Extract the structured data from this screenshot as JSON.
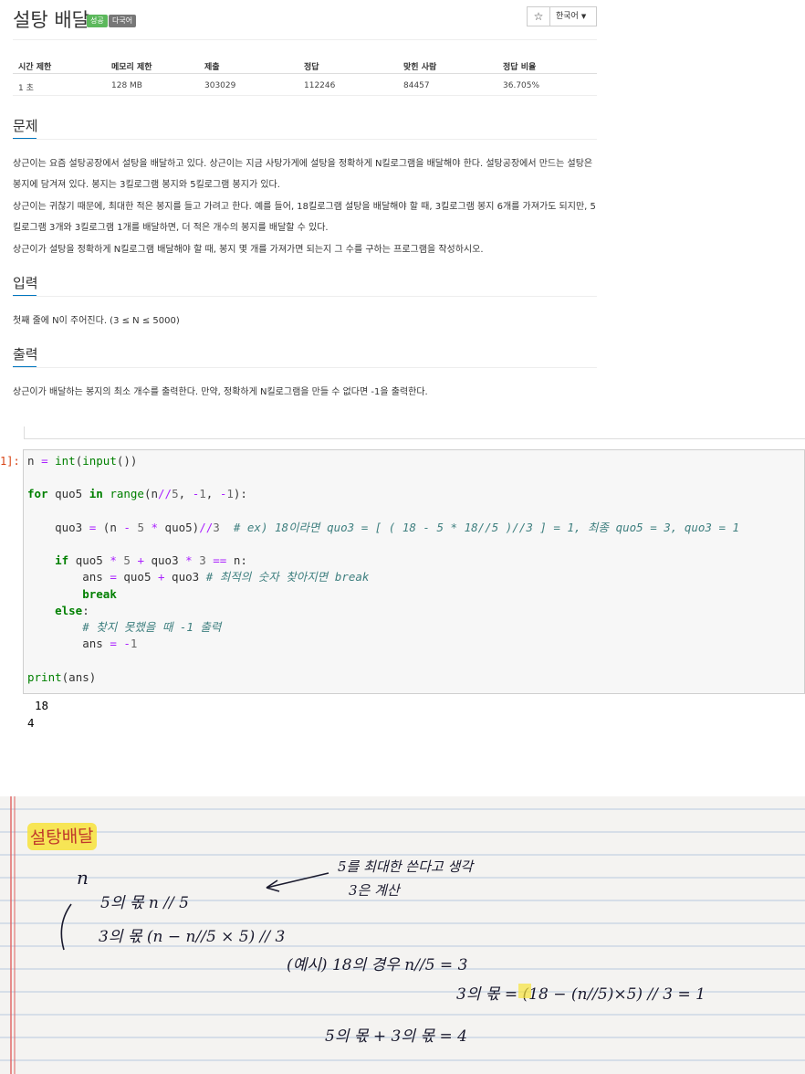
{
  "problem": {
    "title": "설탕 배달",
    "badge_success": "성공",
    "badge_multilang": "다국어",
    "star": "☆",
    "language": "한국어"
  },
  "info_table": {
    "headers": [
      "시간 제한",
      "메모리 제한",
      "제출",
      "정답",
      "맞힌 사람",
      "정답 비율"
    ],
    "values": [
      "1 초",
      "128 MB",
      "303029",
      "112246",
      "84457",
      "36.705%"
    ]
  },
  "sections": {
    "problem_title": "문제",
    "problem_p1": "상근이는 요즘 설탕공장에서 설탕을 배달하고 있다. 상근이는 지금 사탕가게에 설탕을 정확하게 N킬로그램을 배달해야 한다. 설탕공장에서 만드는 설탕은 봉지에 담겨져 있다. 봉지는 3킬로그램 봉지와 5킬로그램 봉지가 있다.",
    "problem_p2": "상근이는 귀찮기 때문에, 최대한 적은 봉지를 들고 가려고 한다. 예를 들어, 18킬로그램 설탕을 배달해야 할 때, 3킬로그램 봉지 6개를 가져가도 되지만, 5킬로그램 3개와 3킬로그램 1개를 배달하면, 더 적은 개수의 봉지를 배달할 수 있다.",
    "problem_p3": "상근이가 설탕을 정확하게 N킬로그램 배달해야 할 때, 봉지 몇 개를 가져가면 되는지 그 수를 구하는 프로그램을 작성하시오.",
    "input_title": "입력",
    "input_p": "첫째 줄에 N이 주어진다. (3 ≤ N ≤ 5000)",
    "output_title": "출력",
    "output_p": "상근이가 배달하는 봉지의 최소 개수를 출력한다. 만약, 정확하게 N킬로그램을 만들 수 없다면 -1을 출력한다."
  },
  "notebook": {
    "prompt": "1]:",
    "code_lines": [
      "n = int(input())",
      "",
      "for quo5 in range(n//5, -1, -1):",
      "",
      "    quo3 = (n - 5 * quo5)//3  # ex) 18이라면 quo3 = [ ( 18 - 5 * 18//5 )//3 ] = 1, 최종 quo5 = 3, quo3 = 1",
      "",
      "    if quo5 * 5 + quo3 * 3 == n:",
      "        ans = quo5 + quo3 # 최적의 숫자 찾아지면 break",
      "        break",
      "    else:",
      "        # 찾지 못했을 때 -1 출력",
      "        ans = -1",
      "",
      "print(ans)"
    ],
    "stdin": "18",
    "stdout": "4"
  },
  "handwritten_note": {
    "title": "설탕배달",
    "line_n": "n",
    "note_right_1": "5를 최대한 쓴다고 생각",
    "note_right_2": "3은 계산",
    "line_5": "5의 몫    n // 5",
    "line_3": "3의 몫    (n − n//5 × 5) // 3",
    "line_ex": "(예시) 18의 경우    n//5 = 3",
    "line_calc": "3의 몫 = (18 − (n//5)×5) // 3 = 1",
    "line_total": "5의 몫 + 3의 몫 = 4"
  },
  "colors": {
    "section_accent": "#0076c0",
    "badge_success": "#5cb85c",
    "badge_multilang": "#777777",
    "highlighter": "#f7e23a",
    "ink": "#1a1a2e",
    "margin_line": "#e06060",
    "rule_line": "#b7c9de"
  }
}
